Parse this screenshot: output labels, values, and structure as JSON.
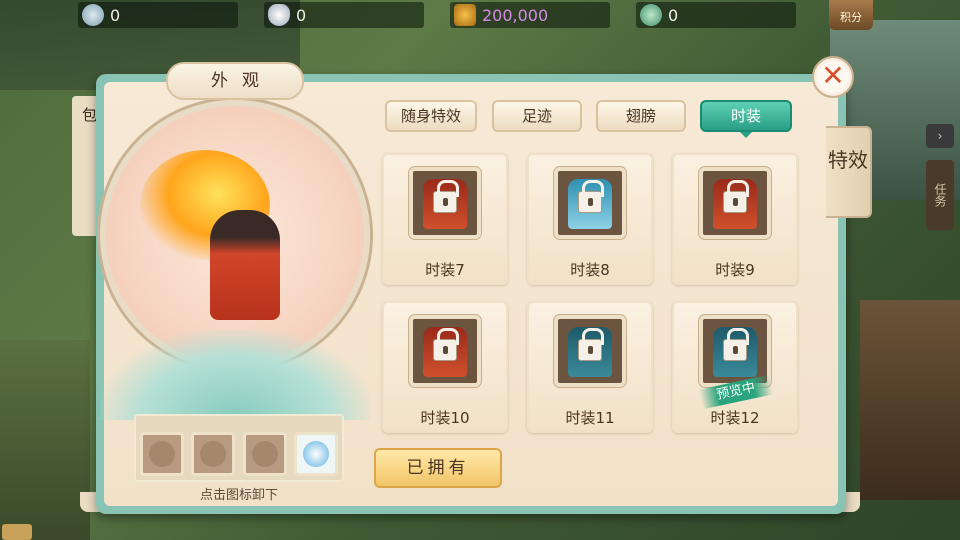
{
  "currencies": [
    {
      "name": "jade-icon",
      "value": "0"
    },
    {
      "name": "silver-ingot-icon",
      "value": "0"
    },
    {
      "name": "copper-coin-icon",
      "value": "200,000"
    },
    {
      "name": "jade-plus-icon",
      "value": "0"
    }
  ],
  "points_label": "积分",
  "panel": {
    "title": "外观",
    "slots_hint": "点击图标卸下",
    "owned_button": "已拥有",
    "side_tab": "特效",
    "close_symbol": "✕"
  },
  "tabs": [
    {
      "label": "随身特效",
      "active": false
    },
    {
      "label": "足迹",
      "active": false
    },
    {
      "label": "翅膀",
      "active": false
    },
    {
      "label": "时装",
      "active": true
    }
  ],
  "outfits": [
    {
      "name": "时装7",
      "locked": true,
      "color": "red"
    },
    {
      "name": "时装8",
      "locked": true,
      "color": "blue"
    },
    {
      "name": "时装9",
      "locked": true,
      "color": "red"
    },
    {
      "name": "时装10",
      "locked": true,
      "color": "red"
    },
    {
      "name": "时装11",
      "locked": true,
      "color": "teal"
    },
    {
      "name": "时装12",
      "locked": true,
      "color": "teal",
      "badge": "预览中"
    }
  ],
  "background_text": {
    "left_panel": "包裹",
    "right_task": "任务"
  },
  "accent_color": "#2a9f86"
}
